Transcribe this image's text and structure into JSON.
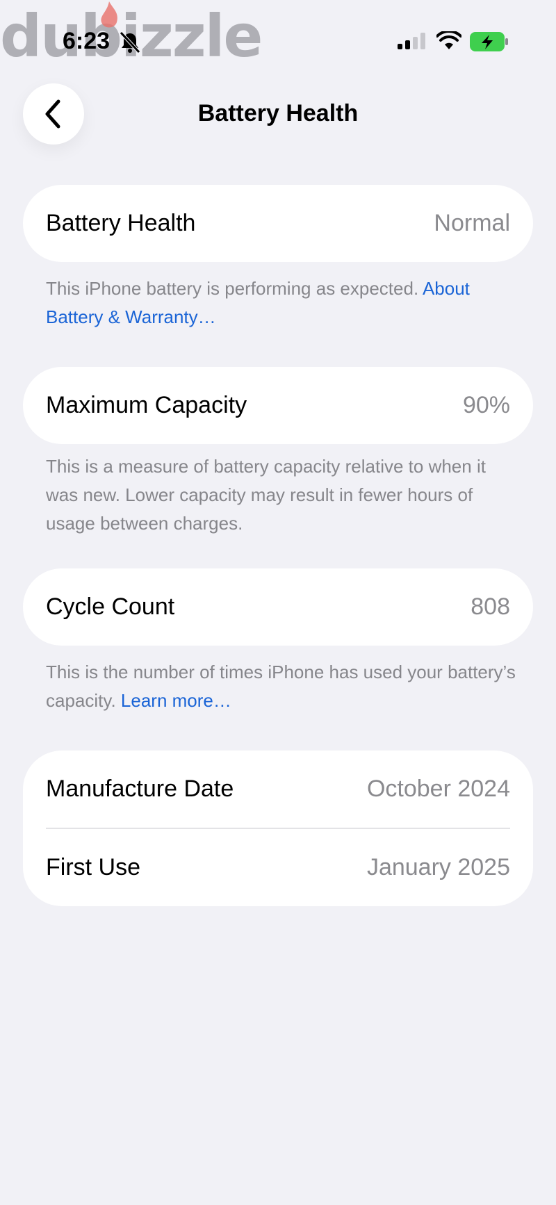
{
  "watermark": {
    "text": "dubizzle"
  },
  "status_bar": {
    "time": "6:23",
    "icons": [
      "bell-slash-icon",
      "cellular-signal-icon",
      "wifi-icon",
      "battery-charging-icon"
    ],
    "battery_color": "#3fcf4e"
  },
  "nav": {
    "back_icon": "chevron-left-icon",
    "title": "Battery Health"
  },
  "sections": {
    "health": {
      "label": "Battery Health",
      "value": "Normal",
      "footnote": "This iPhone battery is performing as expected. ",
      "link": "About Battery & Warranty…"
    },
    "capacity": {
      "label": "Maximum Capacity",
      "value": "90%",
      "footnote": "This is a measure of battery capacity relative to when it was new. Lower capacity may result in fewer hours of usage between charges."
    },
    "cycles": {
      "label": "Cycle Count",
      "value": "808",
      "footnote": "This is the number of times iPhone has used your battery’s capacity. ",
      "link": "Learn more…"
    },
    "dates": {
      "manufacture_label": "Manufacture Date",
      "manufacture_value": "October 2024",
      "first_use_label": "First Use",
      "first_use_value": "January 2025"
    }
  },
  "colors": {
    "background": "#f1f1f6",
    "card": "#ffffff",
    "link": "#1a64d6",
    "secondary_text": "#8a8a8e"
  }
}
